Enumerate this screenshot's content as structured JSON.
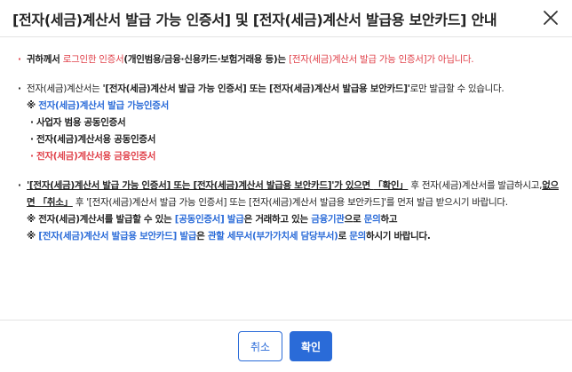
{
  "dialog": {
    "title": "[전자(세금)계산서 발급 가능 인증서] 및 [전자(세금)계산서 발급용 보안카드] 안내",
    "close_icon": "close-icon"
  },
  "para1": {
    "a": "귀하께서 ",
    "b": "로그인한 인증서",
    "c": "(개인범용/금융·신용카드·보험거래용 등)는 ",
    "d": "[전자(세금)계산서 발급 가능 인증서]가 아닙니다."
  },
  "para2": {
    "a": "전자(세금)계산서는 ",
    "b": "'[전자(세금)계산서 발급 가능 인증서] 또는 [전자(세금)계산서 발급용 보안카드]'",
    "c": "로만 발급할 수 있습니다.",
    "note_mark": "※ ",
    "note": "전자(세금)계산서 발급 가능인증서",
    "items": [
      "· 사업자 범용 공동인증서",
      "· 전자(세금)계산서용 공동인증서",
      "· 전자(세금)계산서용 금융인증서"
    ]
  },
  "para3": {
    "a": "'[전자(세금)계산서 발급 가능 인증서] 또는 [전자(세금)계산서 발급용 보안카드]'가 있으면 ",
    "b": "「확인」",
    "c": " 후 전자(세금)계산서를 발급하시고,",
    "d": "없으면 「취소」",
    "e": " 후 '[전자(세금)계산서 발급 가능 인증서] 또는 [전자(세금)계산서 발급용 보안카드]'를 먼저 발급 받으시기 바랍니다.",
    "n1a": "※ 전자(세금)계산서를 발급할 수 있는 ",
    "n1b": "[공동인증서] 발급",
    "n1c": "은 거래하고 있는 ",
    "n1d": "금융기관",
    "n1e": "으로 ",
    "n1f": "문의",
    "n1g": "하고",
    "n2a": "※ ",
    "n2b": "[전자(세금)계산서 발급용 보안카드] 발급",
    "n2c": "은 ",
    "n2d": "관할 세무서(부가가치세 담당부서)",
    "n2e": "로 ",
    "n2f": "문의",
    "n2g": "하시기 바랍니다."
  },
  "footer": {
    "cancel_label": "취소",
    "ok_label": "확인"
  },
  "colors": {
    "accent": "#2a6bd8",
    "warning": "#e0414a"
  }
}
